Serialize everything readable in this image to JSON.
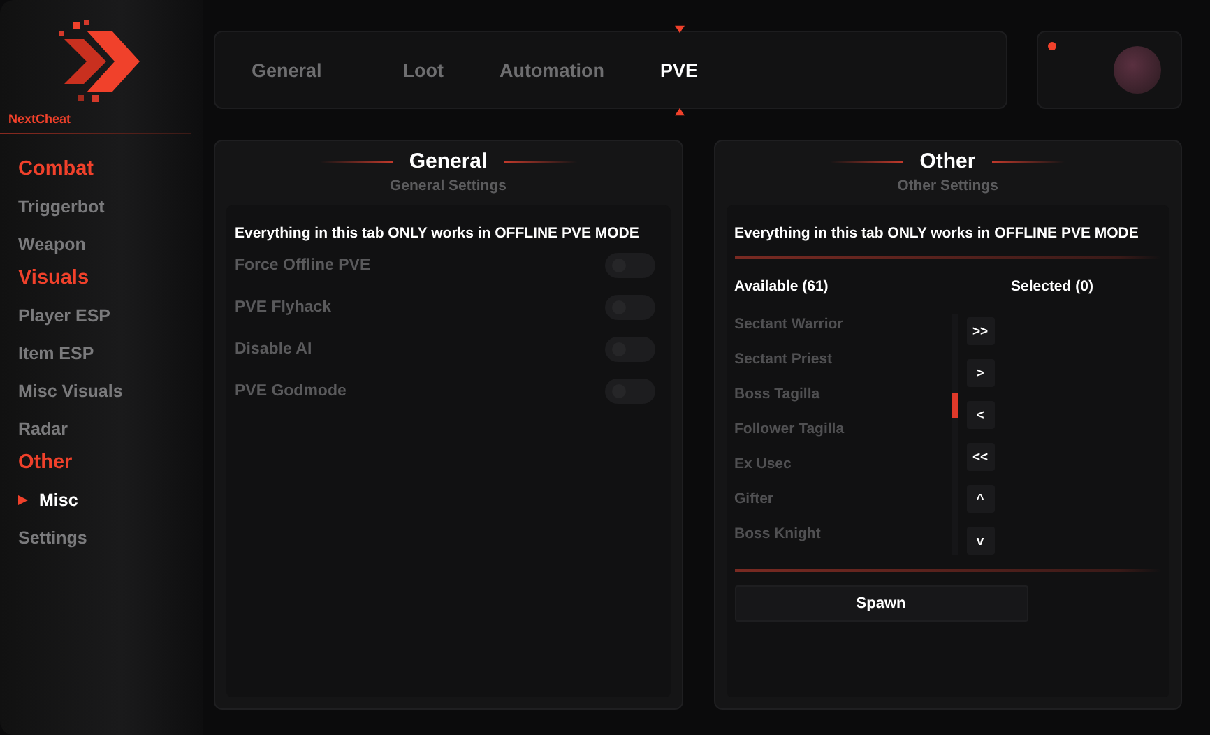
{
  "brand": {
    "name": "NextCheat"
  },
  "sidebar": {
    "sections": [
      {
        "title": "Combat",
        "items": [
          {
            "label": "Triggerbot",
            "selected": false
          },
          {
            "label": "Weapon",
            "selected": false
          }
        ]
      },
      {
        "title": "Visuals",
        "items": [
          {
            "label": "Player ESP",
            "selected": false
          },
          {
            "label": "Item ESP",
            "selected": false
          },
          {
            "label": "Misc Visuals",
            "selected": false
          },
          {
            "label": "Radar",
            "selected": false
          }
        ]
      },
      {
        "title": "Other",
        "items": [
          {
            "label": "Misc",
            "selected": true
          },
          {
            "label": "Settings",
            "selected": false
          }
        ]
      }
    ]
  },
  "tabs": [
    {
      "label": "General",
      "selected": false
    },
    {
      "label": "Loot",
      "selected": false
    },
    {
      "label": "Automation",
      "selected": false
    },
    {
      "label": "PVE",
      "selected": true
    }
  ],
  "general_panel": {
    "title": "General",
    "subtitle": "General Settings",
    "notice": "Everything in this tab ONLY works in OFFLINE PVE MODE",
    "toggles": [
      {
        "label": "Force Offline PVE",
        "on": false
      },
      {
        "label": "PVE Flyhack",
        "on": false
      },
      {
        "label": "Disable AI",
        "on": false
      },
      {
        "label": "PVE Godmode",
        "on": false
      }
    ]
  },
  "other_panel": {
    "title": "Other",
    "subtitle": "Other Settings",
    "notice": "Everything in this tab ONLY works in OFFLINE PVE MODE",
    "available_heading": "Available (61)",
    "selected_heading": "Selected (0)",
    "available": [
      "Sectant Warrior",
      "Sectant Priest",
      "Boss Tagilla",
      "Follower Tagilla",
      "Ex Usec",
      "Gifter",
      "Boss Knight"
    ],
    "move_buttons": [
      ">>",
      ">",
      "<",
      "<<",
      "^",
      "v"
    ],
    "spawn_button": "Spawn"
  }
}
